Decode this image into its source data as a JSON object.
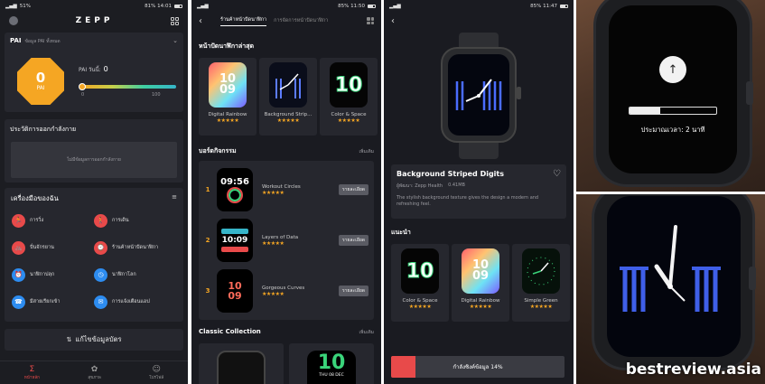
{
  "panel1": {
    "status": {
      "left": "51%",
      "right": "81% 14:01"
    },
    "app_logo": "ZEPP",
    "pai": {
      "title": "PAI",
      "subtitle": "ข้อมูล PAI ทั้งหมด",
      "value": "0",
      "badge_label": "PAI",
      "today_label": "PAI วันนี้:",
      "today_value": "0",
      "scale_min": "0",
      "scale_max": "100",
      "progress": 0
    },
    "workout": {
      "title": "ประวัติการออกกำลังกาย",
      "empty_text": "ไม่มีข้อมูลการออกกำลังกาย"
    },
    "tools": {
      "title": "เครื่องมือของฉัน",
      "items": [
        {
          "label": "การวิ่ง",
          "color": "#e84a4a",
          "icon": "running-icon"
        },
        {
          "label": "การเดิน",
          "color": "#e84a4a",
          "icon": "walking-icon"
        },
        {
          "label": "ปั่นจักรยาน",
          "color": "#e84a4a",
          "icon": "cycling-icon"
        },
        {
          "label": "ร้านค้าหน้าปัดนาฬิกา",
          "color": "#e84a4a",
          "icon": "store-icon"
        },
        {
          "label": "นาฬิกาปลุก",
          "color": "#2d8cf0",
          "icon": "alarm-icon"
        },
        {
          "label": "นาฬิกาโลก",
          "color": "#2d8cf0",
          "icon": "world-clock-icon"
        },
        {
          "label": "มีสายเรียกเข้า",
          "color": "#2d8cf0",
          "icon": "phone-icon"
        },
        {
          "label": "การแจ้งเตือนแอป",
          "color": "#2d8cf0",
          "icon": "notification-icon"
        }
      ]
    },
    "edit_button": "แก้ไขข้อมูลบัตร",
    "nav": [
      {
        "label": "หน้าหลัก",
        "active": true
      },
      {
        "label": "สุขภาพ",
        "active": false
      },
      {
        "label": "โปรไฟล์",
        "active": false
      }
    ]
  },
  "panel2": {
    "status": {
      "left": "",
      "right": "85% 11:50"
    },
    "tabs": [
      "ร้านค้าหน้าปัดนาฬิกา",
      "การจัดการหน้าปัดนาฬิกา"
    ],
    "latest_title": "หน้าปัดนาฬิกาล่าสุด",
    "latest": [
      {
        "name": "Digital Rainbow",
        "stars": "★★★★★"
      },
      {
        "name": "Background Strip...",
        "stars": "★★★★★"
      },
      {
        "name": "Color & Space",
        "stars": "★★★★★"
      }
    ],
    "ranking_title": "บอร์ดกิจกรรม",
    "ranking_more": "เพิ่มเติม",
    "ranking": [
      {
        "rank": "1",
        "name": "Workout Circles",
        "stars": "★★★★★",
        "button": "รายละเอียด",
        "time": "09:56"
      },
      {
        "rank": "2",
        "name": "Layers of Data",
        "stars": "★★★★★",
        "button": "รายละเอียด",
        "time": "10:09"
      },
      {
        "rank": "3",
        "name": "Gorgeous Curves",
        "stars": "★★★★★",
        "button": "รายละเอียด",
        "time": "10 09"
      }
    ],
    "classic_title": "Classic Collection",
    "classic_more": "เพิ่มเติม",
    "classic_digit": "10",
    "classic_date": "THU 08 DEC"
  },
  "panel3": {
    "status": {
      "left": "",
      "right": "85% 11:47"
    },
    "title": "Background Striped Digits",
    "author": "ผู้พัฒนา: Zepp Health",
    "size": "0.41MB",
    "description": "The stylish background texture gives the design a modern and refreshing feel.",
    "recommend_title": "แนะนำ",
    "recommend": [
      {
        "name": "Color & Space",
        "stars": "★★★★★"
      },
      {
        "name": "Digital Rainbow",
        "stars": "★★★★★"
      },
      {
        "name": "Simple Green",
        "stars": "★★★★★"
      }
    ],
    "sync_text": "กำลังซิงค์ข้อมูล 14%",
    "sync_progress": 0.14
  },
  "photo1": {
    "screen_text": "ประมาณเวลา: 2 นาที",
    "progress": 0.35
  },
  "photo2": {
    "watermark": "bestreview.asia"
  }
}
